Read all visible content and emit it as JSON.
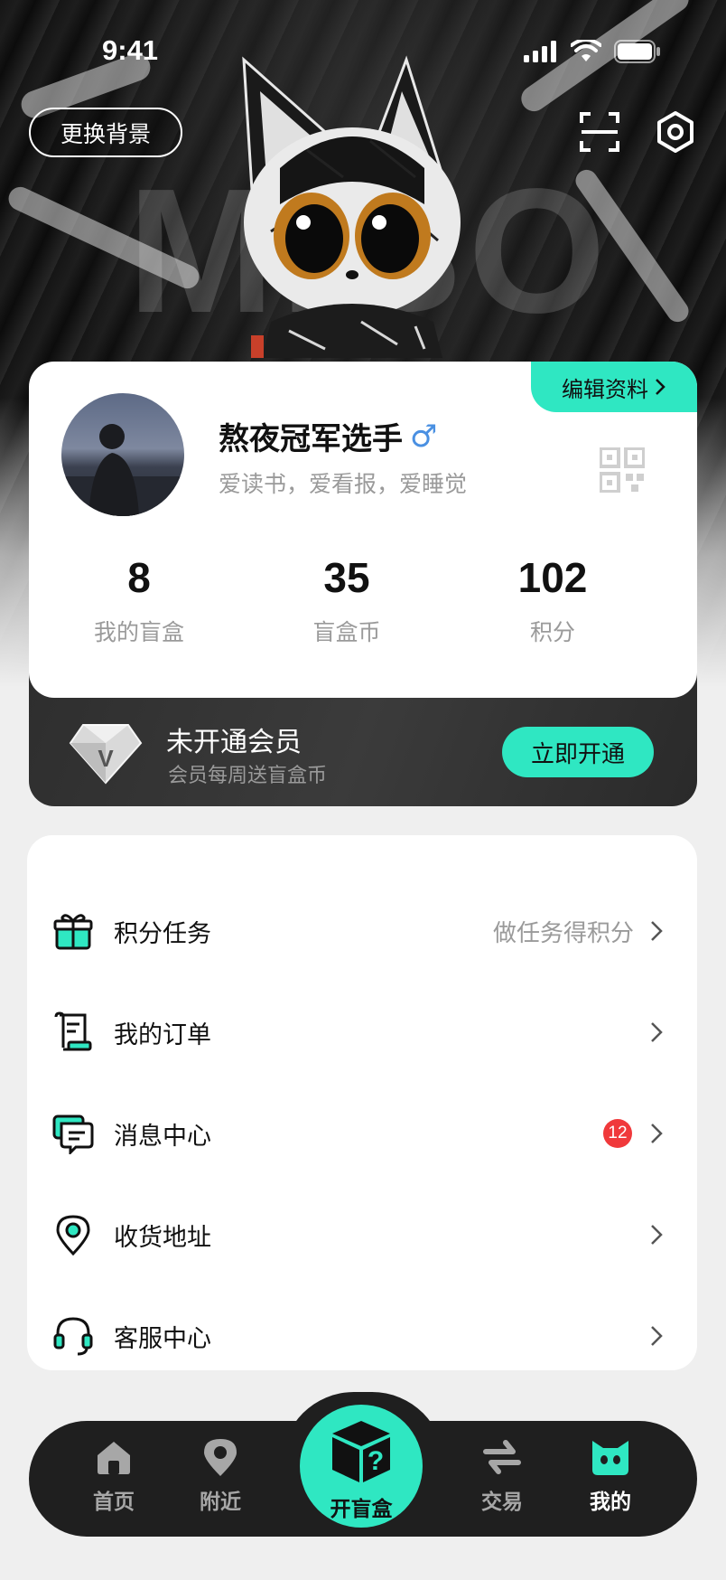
{
  "status_bar": {
    "time": "9:41"
  },
  "hero": {
    "change_background_label": "更换背景",
    "wordmark": "MIBO"
  },
  "profile": {
    "edit_label": "编辑资料",
    "nickname": "熬夜冠军选手",
    "gender_symbol": "♂",
    "bio": "爱读书，爱看报，爱睡觉",
    "stats": [
      {
        "value": "8",
        "label": "我的盲盒"
      },
      {
        "value": "35",
        "label": "盲盒币"
      },
      {
        "value": "102",
        "label": "积分"
      }
    ]
  },
  "vip": {
    "icon_letter": "V",
    "title": "未开通会员",
    "subtitle": "会员每周送盲盒币",
    "button_label": "立即开通"
  },
  "menu": {
    "items": [
      {
        "label": "积分任务",
        "hint": "做任务得积分",
        "icon": "gift-icon"
      },
      {
        "label": "我的订单",
        "icon": "order-scroll-icon"
      },
      {
        "label": "消息中心",
        "badge": "12",
        "icon": "message-icon"
      },
      {
        "label": "收货地址",
        "icon": "location-pin-icon"
      },
      {
        "label": "客服中心",
        "icon": "headset-icon"
      }
    ]
  },
  "tabbar": {
    "tabs": [
      {
        "label": "首页",
        "icon": "home-icon"
      },
      {
        "label": "附近",
        "icon": "location-icon"
      },
      {
        "label": "开盲盒",
        "icon": "mystery-box-icon"
      },
      {
        "label": "交易",
        "icon": "exchange-icon"
      },
      {
        "label": "我的",
        "icon": "cat-face-icon",
        "active": true
      }
    ]
  },
  "colors": {
    "accent": "#2fe7c2",
    "badge_red": "#f0393b",
    "dark_bar": "#1f1f1f",
    "gender_blue": "#4a90e2"
  }
}
